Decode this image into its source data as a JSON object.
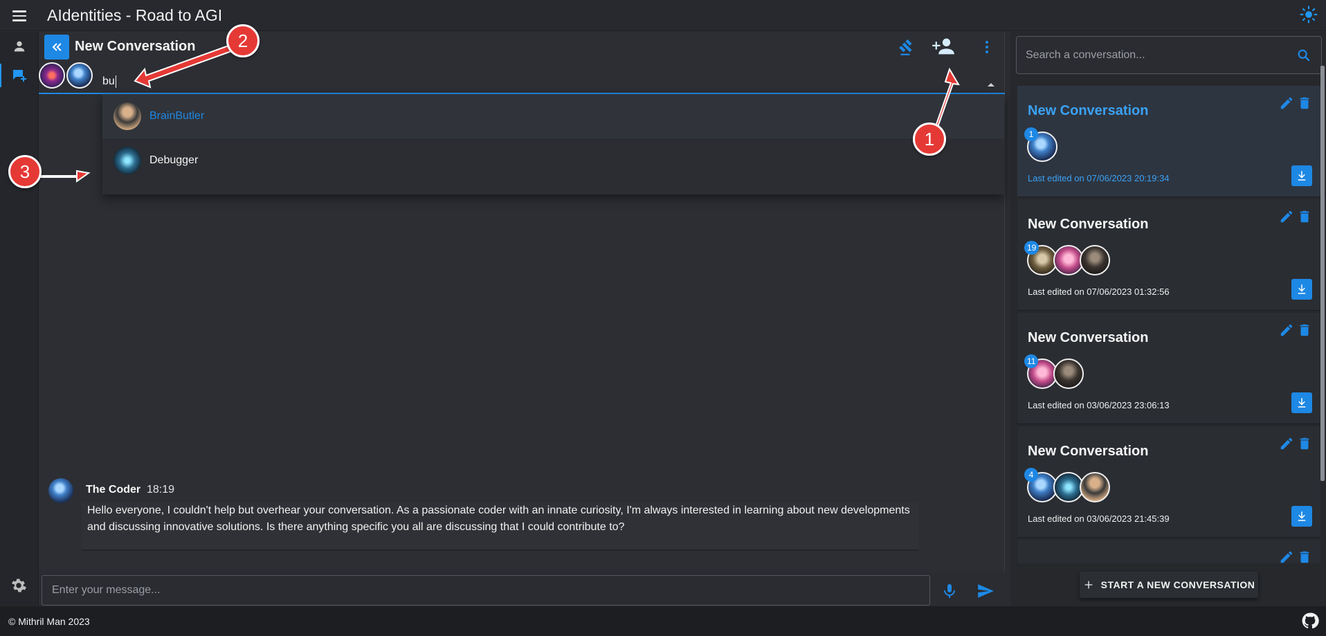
{
  "app": {
    "title": "AIdentities - Road to AGI"
  },
  "chat": {
    "title": "New Conversation",
    "participant_search_value": "bu",
    "autocomplete": [
      {
        "label": "BrainButler",
        "highlighted": true
      },
      {
        "label": "Debugger",
        "highlighted": false
      }
    ],
    "message": {
      "author": "The Coder",
      "time": "18:19",
      "text": "Hello everyone, I couldn't help but overhear your conversation. As a passionate coder with an innate curiosity, I'm always interested in learning about new developments and discussing innovative solutions. Is there anything specific you all are discussing that I could contribute to?"
    },
    "composer_placeholder": "Enter your message..."
  },
  "sidebar": {
    "search_placeholder": "Search a conversation...",
    "conversations": [
      {
        "title": "New Conversation",
        "badge": "1",
        "date": "Last edited on 07/06/2023 20:19:34",
        "selected": true
      },
      {
        "title": "New Conversation",
        "badge": "19",
        "date": "Last edited on 07/06/2023 01:32:56",
        "selected": false
      },
      {
        "title": "New Conversation",
        "badge": "11",
        "date": "Last edited on 03/06/2023 23:06:13",
        "selected": false
      },
      {
        "title": "New Conversation",
        "badge": "4",
        "date": "Last edited on 03/06/2023 21:45:39",
        "selected": false
      }
    ],
    "start_button": "START A NEW CONVERSATION"
  },
  "footer": {
    "text": "© Mithril Man 2023"
  },
  "annotations": [
    "1",
    "2",
    "3"
  ],
  "colors": {
    "accent": "#1e88e5",
    "annotation": "#e53935",
    "background": "#2a2c31"
  }
}
